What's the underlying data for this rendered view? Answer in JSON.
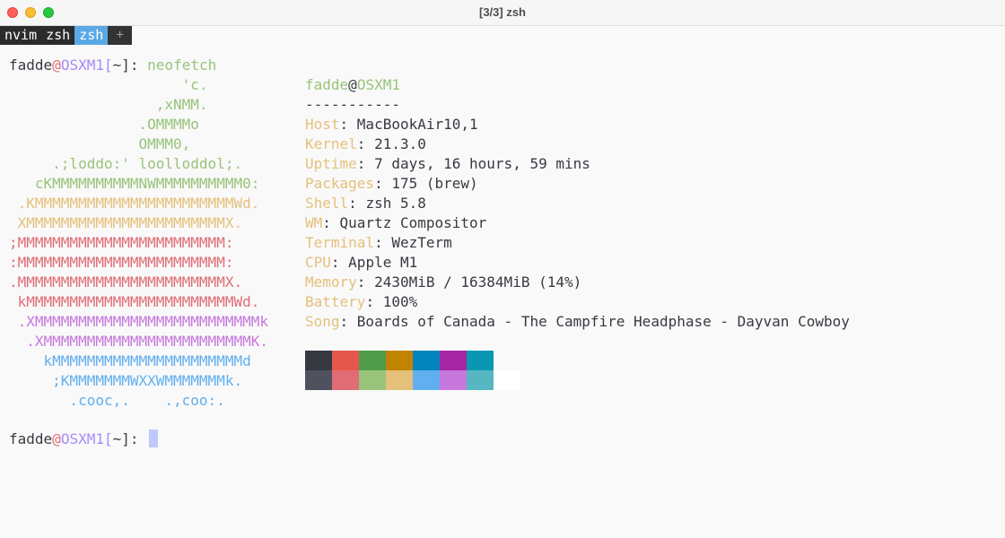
{
  "window": {
    "title": "[3/3] zsh"
  },
  "tabs": [
    {
      "label": "nvim",
      "active": false
    },
    {
      "label": "zsh",
      "active": false
    },
    {
      "label": "zsh",
      "active": true
    },
    {
      "label": "+",
      "active": false
    }
  ],
  "prompt": {
    "user": "fadde",
    "at": "@",
    "host": "OSXM1",
    "open": "[",
    "dir": "~",
    "close": "]",
    "suffix": ": ",
    "command": "neofetch"
  },
  "logo_lines": [
    {
      "text": "                    'c.",
      "color": "#98c379"
    },
    {
      "text": "                 ,xNMM.",
      "color": "#98c379"
    },
    {
      "text": "               .OMMMMo",
      "color": "#98c379"
    },
    {
      "text": "               OMMM0,",
      "color": "#98c379"
    },
    {
      "text": "     .;loddo:' loolloddol;.",
      "color": "#98c379"
    },
    {
      "text": "   cKMMMMMMMMMMNWMMMMMMMMMM0:",
      "color": "#98c379"
    },
    {
      "text": " .KMMMMMMMMMMMMMMMMMMMMMMMWd.",
      "color": "#e5c07b"
    },
    {
      "text": " XMMMMMMMMMMMMMMMMMMMMMMMX.",
      "color": "#e5c07b"
    },
    {
      "text": ";MMMMMMMMMMMMMMMMMMMMMMMM:",
      "color": "#e06c75"
    },
    {
      "text": ":MMMMMMMMMMMMMMMMMMMMMMMM:",
      "color": "#e06c75"
    },
    {
      "text": ".MMMMMMMMMMMMMMMMMMMMMMMMX.",
      "color": "#e06c75"
    },
    {
      "text": " kMMMMMMMMMMMMMMMMMMMMMMMMWd.",
      "color": "#e06c75"
    },
    {
      "text": " .XMMMMMMMMMMMMMMMMMMMMMMMMMMk",
      "color": "#c678dd"
    },
    {
      "text": "  .XMMMMMMMMMMMMMMMMMMMMMMMMK.",
      "color": "#c678dd"
    },
    {
      "text": "    kMMMMMMMMMMMMMMMMMMMMMMd",
      "color": "#61afef"
    },
    {
      "text": "     ;KMMMMMMMWXXWMMMMMMMk.",
      "color": "#61afef"
    },
    {
      "text": "       .cooc,.    .,coo:.",
      "color": "#61afef"
    }
  ],
  "info": {
    "user": "fadde",
    "at": "@",
    "host": "OSXM1",
    "separator": "-----------",
    "rows": [
      {
        "key": "Host",
        "value": "MacBookAir10,1"
      },
      {
        "key": "Kernel",
        "value": "21.3.0"
      },
      {
        "key": "Uptime",
        "value": "7 days, 16 hours, 59 mins"
      },
      {
        "key": "Packages",
        "value": "175 (brew)"
      },
      {
        "key": "Shell",
        "value": "zsh 5.8"
      },
      {
        "key": "WM",
        "value": "Quartz Compositor"
      },
      {
        "key": "Terminal",
        "value": "WezTerm"
      },
      {
        "key": "CPU",
        "value": "Apple M1"
      },
      {
        "key": "Memory",
        "value": "2430MiB / 16384MiB (14%)"
      },
      {
        "key": "Battery",
        "value": "100%"
      },
      {
        "key": "Song",
        "value": "Boards of Canada - The Campfire Headphase - Dayvan Cowboy"
      }
    ],
    "key_separator": ": "
  },
  "palette": {
    "normal": [
      "#353a42",
      "#e6574b",
      "#4f9c4a",
      "#c18401",
      "#0184bc",
      "#a626a4",
      "#0997b3",
      "#f9f9f9"
    ],
    "bright": [
      "#4f525e",
      "#e06c75",
      "#98c379",
      "#e5c07b",
      "#61afef",
      "#c678dd",
      "#56b6c2",
      "#ffffff"
    ]
  }
}
